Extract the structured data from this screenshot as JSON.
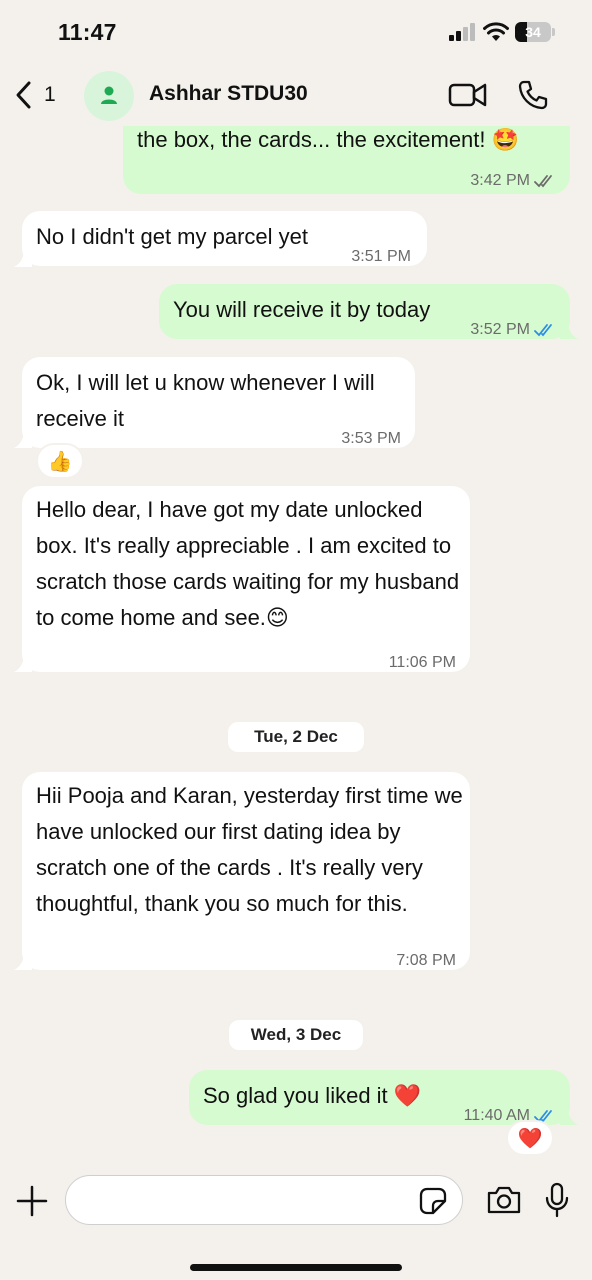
{
  "status_bar": {
    "time": "11:47",
    "battery": "34",
    "battery_level": 0.34
  },
  "header": {
    "back_count": "1",
    "contact_name": "Ashhar STDU30"
  },
  "messages": [
    {
      "text": "the box, the cards... the excitement! 🤩",
      "time": "3:42 PM",
      "status": "delivered"
    },
    {
      "text": "No I didn't get my parcel yet",
      "time": "3:51 PM"
    },
    {
      "text": "You will receive it by today",
      "time": "3:52 PM",
      "status": "read"
    },
    {
      "text": "Ok, I will let u know whenever I will receive it",
      "time": "3:53 PM",
      "reaction": "👍"
    },
    {
      "text": "Hello dear, I have got my date unlocked box. It's really appreciable . I am excited to scratch those cards waiting for my husband to come home and see.😊",
      "time": "11:06 PM"
    },
    {
      "text": "Hii Pooja and Karan, yesterday first time we have unlocked our first dating idea by scratch one of the cards . It's really very thoughtful, thank you so much for this.",
      "time": "7:08 PM"
    },
    {
      "text": "So glad you liked it ❤️",
      "time": "11:40 AM",
      "status": "read",
      "reaction": "❤️"
    }
  ],
  "date_separators": [
    "Tue, 2 Dec",
    "Wed, 3 Dec"
  ],
  "composer": {
    "value": ""
  },
  "colors": {
    "background": "#f4f1ec",
    "incoming_bubble": "#ffffff",
    "outgoing_bubble": "#d7fbd0",
    "read_tick": "#2c8ee8",
    "delivered_tick": "#6b6b6b",
    "avatar_bg": "#d8f5dc",
    "avatar_fg": "#1ea952"
  }
}
